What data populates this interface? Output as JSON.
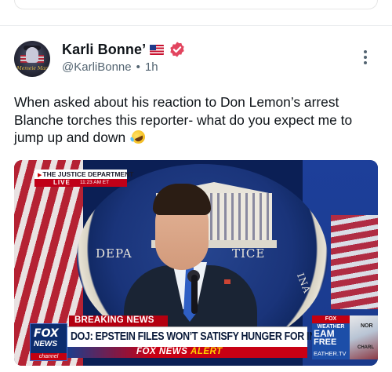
{
  "post": {
    "author_name": "Karli Bonne’",
    "author_handle": "@KarliBonne",
    "separator": "•",
    "time_ago": "1h",
    "avatar_text": "Memeie Mar",
    "text": "When asked about his reaction to Don Lemon’s arrest Blanche torches this reporter- what do you expect me to jump up and down"
  },
  "icons": {
    "flag": "us-flag-icon",
    "verified": "verified-badge-icon",
    "more": "more-options-icon",
    "emoji": "rolling-on-floor-laughing-emoji"
  },
  "colors": {
    "verified_badge": "#e2455f",
    "text_primary": "#0f1419",
    "text_secondary": "#536471",
    "breaking_red": "#b40010"
  },
  "video": {
    "seal_left_text": "DEPA",
    "seal_right_text": "TICE",
    "seal_bottom_text": "INA",
    "overlay_title": "THE JUSTICE DEPARTMENT",
    "live_label": "LIVE",
    "live_time": "11:23 AM ET",
    "breaking_label": "BREAKING NEWS",
    "headline": "DOJ: EPSTEIN FILES WON’T SATISFY HUNGER FOR INFO",
    "alert_brand": "FOX NEWS",
    "alert_word": "ALERT",
    "logo_top": "FOX",
    "logo_mid": "NEWS",
    "logo_bottom": "channel",
    "weather_tag": "FOX WEATHER",
    "weather_line1": "EAM",
    "weather_line2": "FREE",
    "weather_line3": "EATHER.TV",
    "map_top": "NOR",
    "map_bottom": "CHARL"
  }
}
